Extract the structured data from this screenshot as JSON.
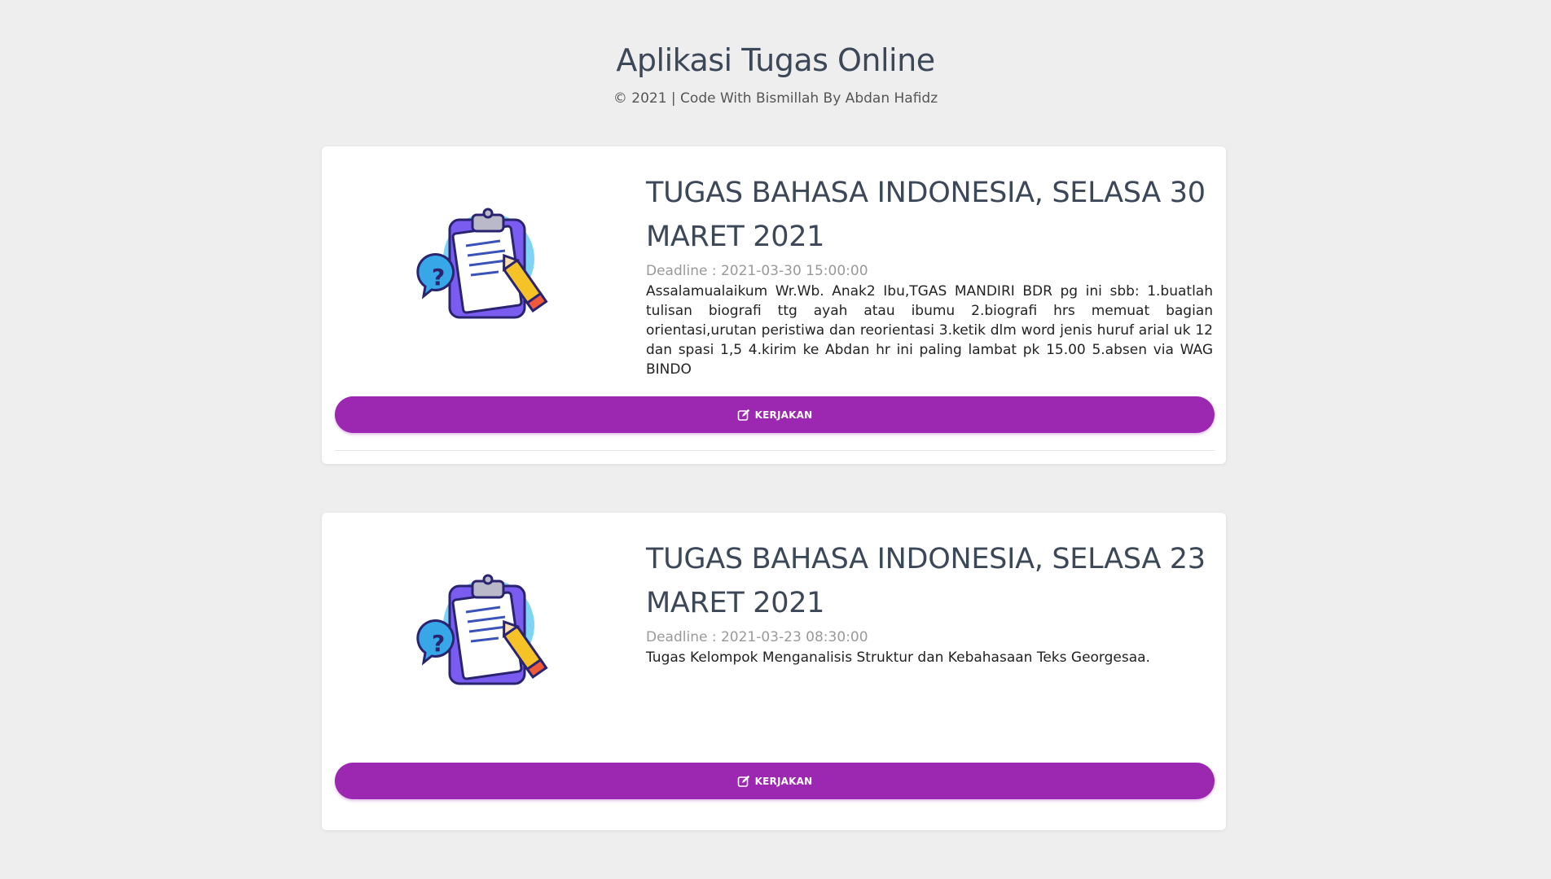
{
  "header": {
    "title": "Aplikasi Tugas Online",
    "subtitle": "© 2021 | Code With Bismillah By Abdan Hafidz"
  },
  "tasks": [
    {
      "title": "TUGAS BAHASA INDONESIA, SELASA 30 MARET 2021",
      "deadline": "Deadline : 2021-03-30 15:00:00",
      "description": "Assalamualaikum Wr.Wb. Anak2 Ibu,TGAS MANDIRI BDR pg ini sbb: 1.buatlah tulisan biografi ttg ayah atau ibumu 2.biografi hrs memuat bagian orientasi,urutan peristiwa dan reorientasi 3.ketik dlm word jenis huruf arial uk 12 dan spasi 1,5 4.kirim ke Abdan hr ini paling lambat pk 15.00 5.absen via WAG BINDO",
      "button_label": "KERJAKAN",
      "illustration": "clipboard-pencil-icon"
    },
    {
      "title": "TUGAS BAHASA INDONESIA, SELASA 23 MARET 2021",
      "deadline": "Deadline : 2021-03-23 08:30:00",
      "description": "Tugas Kelompok Menganalisis Struktur dan Kebahasaan Teks Georgesaa.",
      "button_label": "KERJAKAN",
      "illustration": "clipboard-pencil-icon"
    }
  ],
  "colors": {
    "background": "#eeeeee",
    "primary": "#9c27b0",
    "title": "#3c4858",
    "deadline": "#999999"
  }
}
